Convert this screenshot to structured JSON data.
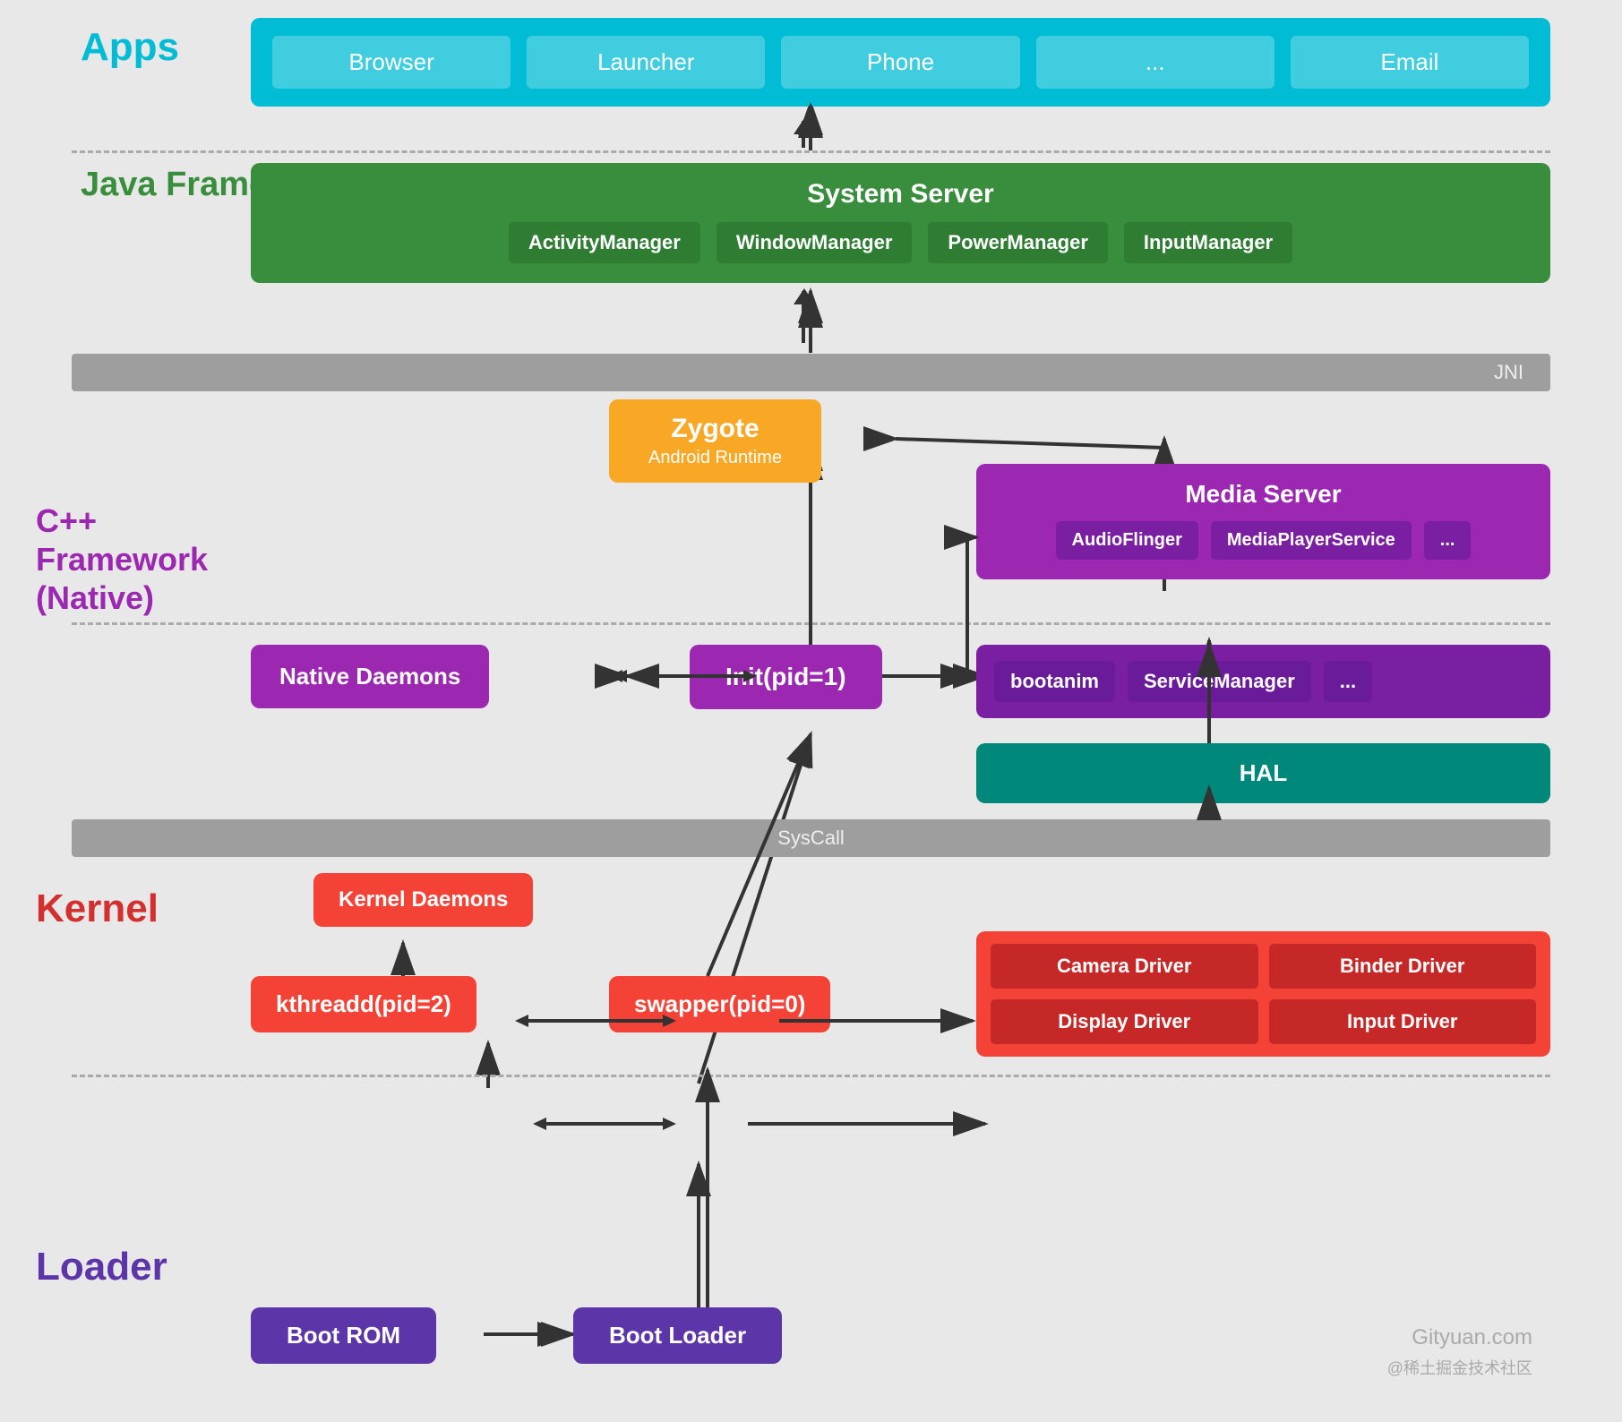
{
  "apps": {
    "label": "Apps",
    "items": [
      "Browser",
      "Launcher",
      "Phone",
      "...",
      "Email"
    ]
  },
  "java_framework": {
    "label": "Java Framework",
    "system_server": {
      "title": "System Server",
      "items": [
        "ActivityManager",
        "WindowManager",
        "PowerManager",
        "InputManager"
      ]
    }
  },
  "jni_label": "JNI",
  "zygote": {
    "title": "Zygote",
    "subtitle": "Android Runtime"
  },
  "cpp_framework": {
    "label": "C++ Framework\n(Native)",
    "label_line1": "C++ Framework",
    "label_line2": "(Native)",
    "media_server": {
      "title": "Media Server",
      "items": [
        "AudioFlinger",
        "MediaPlayerService",
        "..."
      ]
    },
    "init": {
      "label": "Init(pid=1)",
      "sub_items": [
        "bootanim",
        "ServiceManager",
        "..."
      ]
    },
    "native_daemons": "Native Daemons",
    "hal": "HAL"
  },
  "syscall_label": "SysCall",
  "kernel": {
    "label": "Kernel",
    "kernel_daemons": "Kernel Daemons",
    "kthreadd": "kthreadd(pid=2)",
    "swapper": "swapper(pid=0)",
    "drivers": [
      "Camera Driver",
      "Binder Driver",
      "Display Driver",
      "Input Driver"
    ]
  },
  "loader": {
    "label": "Loader",
    "boot_rom": "Boot ROM",
    "boot_loader": "Boot Loader"
  },
  "watermark": "Gityuan.com",
  "watermark2": "@稀土掘金技术社区"
}
